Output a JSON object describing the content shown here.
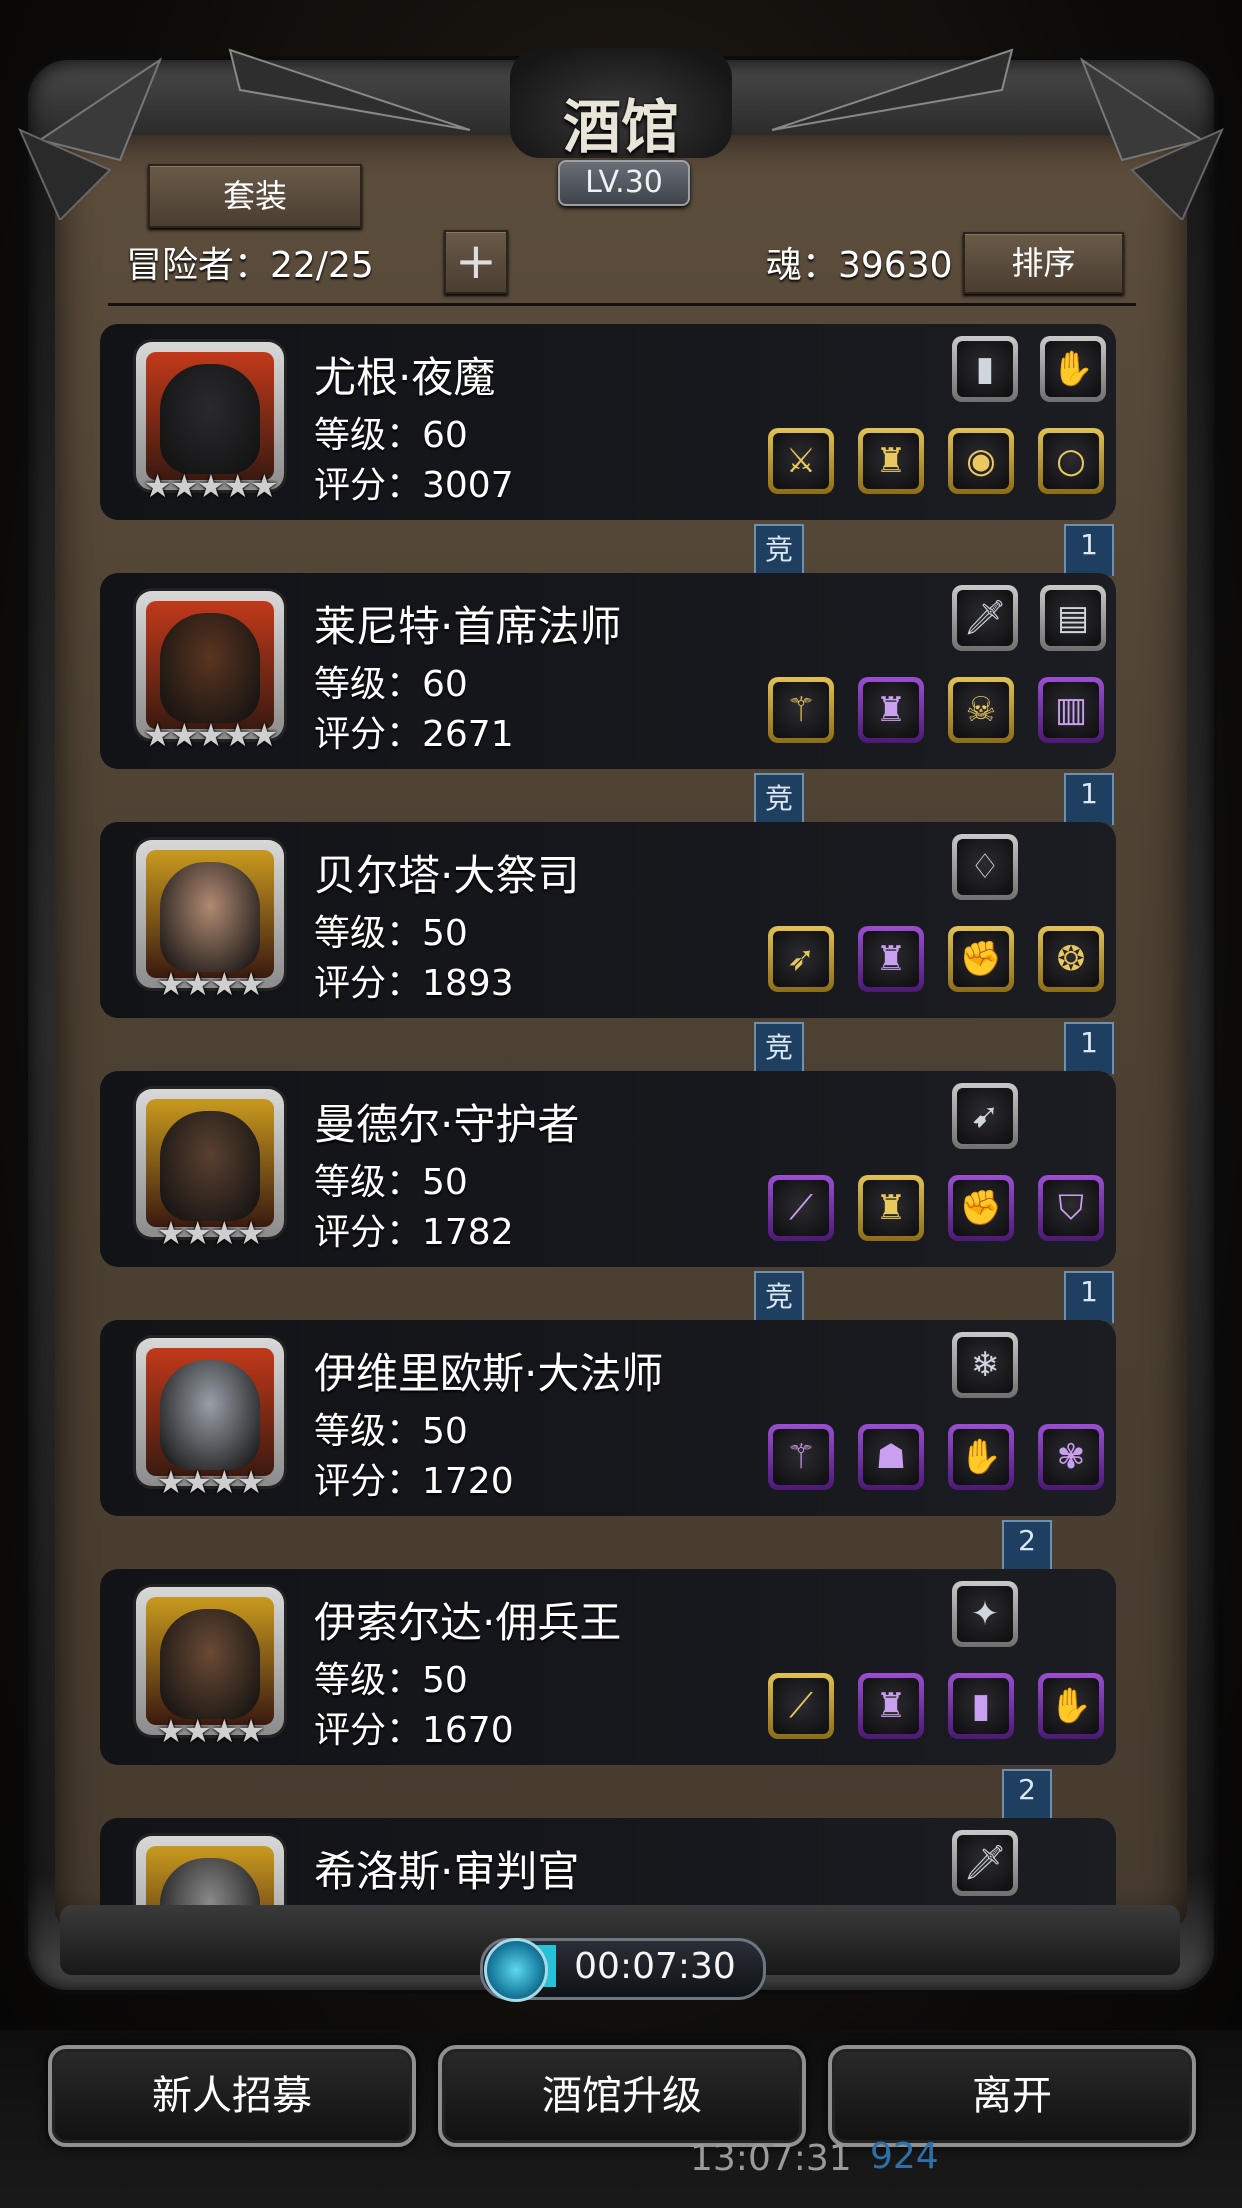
{
  "header": {
    "title": "酒馆",
    "level": "LV.30",
    "set_button": "套装",
    "adventurers_label": "冒险者：22/25",
    "add_button": "+",
    "soul_label": "魂：39630",
    "sort_button": "排序"
  },
  "heroes": [
    {
      "name": "尤根·夜魔",
      "level": "等级：60",
      "score": "评分：3007",
      "stars": "★★★★★",
      "frame": "#c2391a",
      "face": "#2a2a2e",
      "top_slots": [
        {
          "style": "plain",
          "icon": "▮"
        },
        {
          "style": "plain",
          "icon": "✋"
        }
      ],
      "bottom_slots": [
        {
          "style": "gold",
          "icon": "⚔"
        },
        {
          "style": "gold",
          "icon": "♜"
        },
        {
          "style": "gold",
          "icon": "◉"
        },
        {
          "style": "gold",
          "icon": "○"
        }
      ],
      "flag_left": "竞",
      "flag_right": "1"
    },
    {
      "name": "莱尼特·首席法师",
      "level": "等级：60",
      "score": "评分：2671",
      "stars": "★★★★★",
      "frame": "#c2391a",
      "face": "#5a3520",
      "top_slots": [
        {
          "style": "plain",
          "icon": "🗡"
        },
        {
          "style": "plain",
          "icon": "▤"
        }
      ],
      "bottom_slots": [
        {
          "style": "gold",
          "icon": "⚚"
        },
        {
          "style": "purple",
          "icon": "♜"
        },
        {
          "style": "gold",
          "icon": "☠"
        },
        {
          "style": "purple",
          "icon": "▥"
        }
      ],
      "flag_left": "竞",
      "flag_right": "1"
    },
    {
      "name": "贝尔塔·大祭司",
      "level": "等级：50",
      "score": "评分：1893",
      "stars": "★★★★",
      "frame": "#c99a1e",
      "face": "#b08a72",
      "top_slots": [
        {
          "style": "plain",
          "icon": "♢"
        }
      ],
      "bottom_slots": [
        {
          "style": "gold",
          "icon": "➶"
        },
        {
          "style": "purple",
          "icon": "♜"
        },
        {
          "style": "gold",
          "icon": "✊"
        },
        {
          "style": "gold",
          "icon": "❂"
        }
      ],
      "flag_left": "竞",
      "flag_right": "1"
    },
    {
      "name": "曼德尔·守护者",
      "level": "等级：50",
      "score": "评分：1782",
      "stars": "★★★★",
      "frame": "#c99a1e",
      "face": "#5a4030",
      "top_slots": [
        {
          "style": "plain",
          "icon": "➹"
        }
      ],
      "bottom_slots": [
        {
          "style": "purple",
          "icon": "⟋"
        },
        {
          "style": "gold",
          "icon": "♜"
        },
        {
          "style": "purple",
          "icon": "✊"
        },
        {
          "style": "purple",
          "icon": "⛉"
        }
      ],
      "flag_left": "竞",
      "flag_right": "1"
    },
    {
      "name": "伊维里欧斯·大法师",
      "level": "等级：50",
      "score": "评分：1720",
      "stars": "★★★★",
      "frame": "#c2391a",
      "face": "#9aa0a8",
      "top_slots": [
        {
          "style": "plain",
          "icon": "❄"
        }
      ],
      "bottom_slots": [
        {
          "style": "purple",
          "icon": "⚚"
        },
        {
          "style": "purple",
          "icon": "☗"
        },
        {
          "style": "purple",
          "icon": "✋"
        },
        {
          "style": "purple",
          "icon": "✾"
        }
      ],
      "flag_left": "",
      "flag_right": "2"
    },
    {
      "name": "伊索尔达·佣兵王",
      "level": "等级：50",
      "score": "评分：1670",
      "stars": "★★★★",
      "frame": "#c99a1e",
      "face": "#6a4a34",
      "top_slots": [
        {
          "style": "plain",
          "icon": "✦"
        }
      ],
      "bottom_slots": [
        {
          "style": "gold",
          "icon": "⟋"
        },
        {
          "style": "purple",
          "icon": "♜"
        },
        {
          "style": "purple",
          "icon": "▮"
        },
        {
          "style": "purple",
          "icon": "✋"
        }
      ],
      "flag_left": "",
      "flag_right": "2"
    },
    {
      "name": "希洛斯·审判官",
      "level": "等级：",
      "score": "",
      "stars": "",
      "frame": "#c99a1e",
      "face": "#8a8a8a",
      "top_slots": [
        {
          "style": "plain",
          "icon": "🗡"
        }
      ],
      "bottom_slots": [],
      "flag_left": "",
      "flag_right": ""
    }
  ],
  "timer": "00:07:30",
  "buttons": {
    "recruit": "新人招募",
    "upgrade": "酒馆升级",
    "leave": "离开"
  },
  "status": {
    "clock": "13:07:31",
    "gems": "924"
  }
}
